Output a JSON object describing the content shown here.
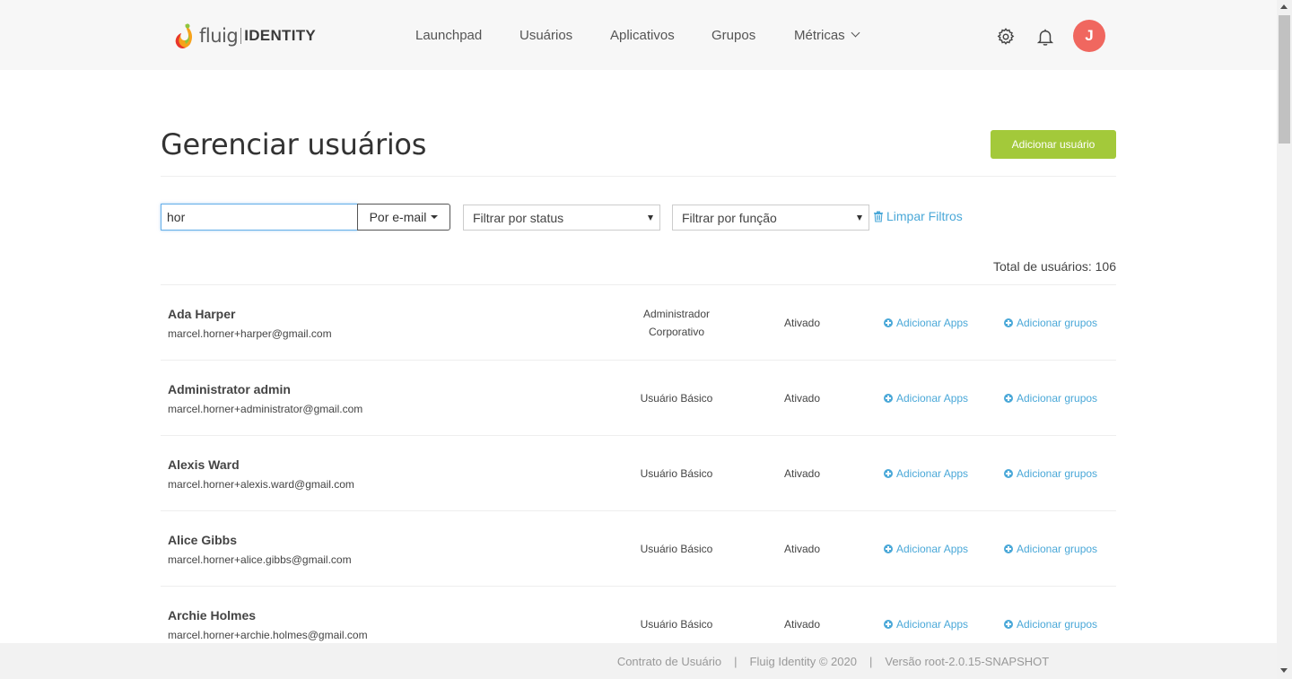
{
  "brand": {
    "logo_text": "fluig",
    "logo_identity": "IDENTITY"
  },
  "nav": {
    "items": [
      {
        "label": "Launchpad"
      },
      {
        "label": "Usuários"
      },
      {
        "label": "Aplicativos"
      },
      {
        "label": "Grupos"
      },
      {
        "label": "Métricas"
      }
    ],
    "settings_icon": "gear-icon",
    "notifications_icon": "bell-icon",
    "avatar_initial": "J"
  },
  "page": {
    "title": "Gerenciar usuários",
    "add_button": "Adicionar usuário"
  },
  "filters": {
    "search_value": "hor",
    "search_type": "Por e-mail",
    "status_placeholder": "Filtrar por status",
    "role_placeholder": "Filtrar por função",
    "clear_label": "Limpar Filtros"
  },
  "total_label": "Total de usuários: 106",
  "actions": {
    "add_apps": "Adicionar Apps",
    "add_groups": "Adicionar grupos"
  },
  "users": [
    {
      "name": "Ada Harper",
      "email": "marcel.horner+harper@gmail.com",
      "role": "Administrador Corporativo",
      "status": "Ativado"
    },
    {
      "name": "Administrator admin",
      "email": "marcel.horner+administrator@gmail.com",
      "role": "Usuário Básico",
      "status": "Ativado"
    },
    {
      "name": "Alexis Ward",
      "email": "marcel.horner+alexis.ward@gmail.com",
      "role": "Usuário Básico",
      "status": "Ativado"
    },
    {
      "name": "Alice Gibbs",
      "email": "marcel.horner+alice.gibbs@gmail.com",
      "role": "Usuário Básico",
      "status": "Ativado"
    },
    {
      "name": "Archie Holmes",
      "email": "marcel.horner+archie.holmes@gmail.com",
      "role": "Usuário Básico",
      "status": "Ativado"
    }
  ],
  "footer": {
    "contract": "Contrato de Usuário",
    "copyright": "Fluig Identity © 2020",
    "version": "Versão root-2.0.15-SNAPSHOT",
    "separator": "|"
  },
  "colors": {
    "accent": "#a3c93a",
    "link": "#4aa8d8",
    "avatar": "#f0675f"
  }
}
